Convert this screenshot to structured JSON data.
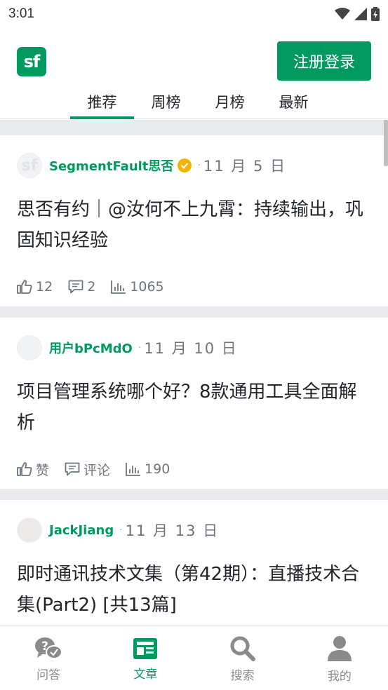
{
  "status_bar": {
    "time": "3:01"
  },
  "header": {
    "logo_text": "sf",
    "login_button": "注册登录",
    "tabs": [
      {
        "label": "推荐",
        "active": true
      },
      {
        "label": "周榜",
        "active": false
      },
      {
        "label": "月榜",
        "active": false
      },
      {
        "label": "最新",
        "active": false
      }
    ]
  },
  "articles": [
    {
      "author": "SegmentFault思否",
      "verified": true,
      "date": "11 月 5 日",
      "title": "思否有约｜@汝何不上九霄：持续输出，巩固知识经验",
      "likes": "12",
      "comments": "2",
      "views": "1065"
    },
    {
      "author": "用户bPcMdO",
      "verified": false,
      "date": "11 月 10 日",
      "title": "项目管理系统哪个好？8款通用工具全面解析",
      "likes": "赞",
      "comments": "评论",
      "views": "190"
    },
    {
      "author": "JackJiang",
      "verified": false,
      "date": "11 月 13 日",
      "title": "即时通讯技术文集（第42期）：直播技术合集(Part2) [共13篇]",
      "likes": "",
      "comments": "",
      "views": ""
    }
  ],
  "bottom_nav": [
    {
      "label": "问答",
      "icon": "qa-icon",
      "active": false
    },
    {
      "label": "文章",
      "icon": "article-icon",
      "active": true
    },
    {
      "label": "搜索",
      "icon": "search-icon",
      "active": false
    },
    {
      "label": "我的",
      "icon": "user-icon",
      "active": false
    }
  ],
  "colors": {
    "brand": "#009a61",
    "verified": "#f5b400",
    "divider": "#e9ecef"
  }
}
